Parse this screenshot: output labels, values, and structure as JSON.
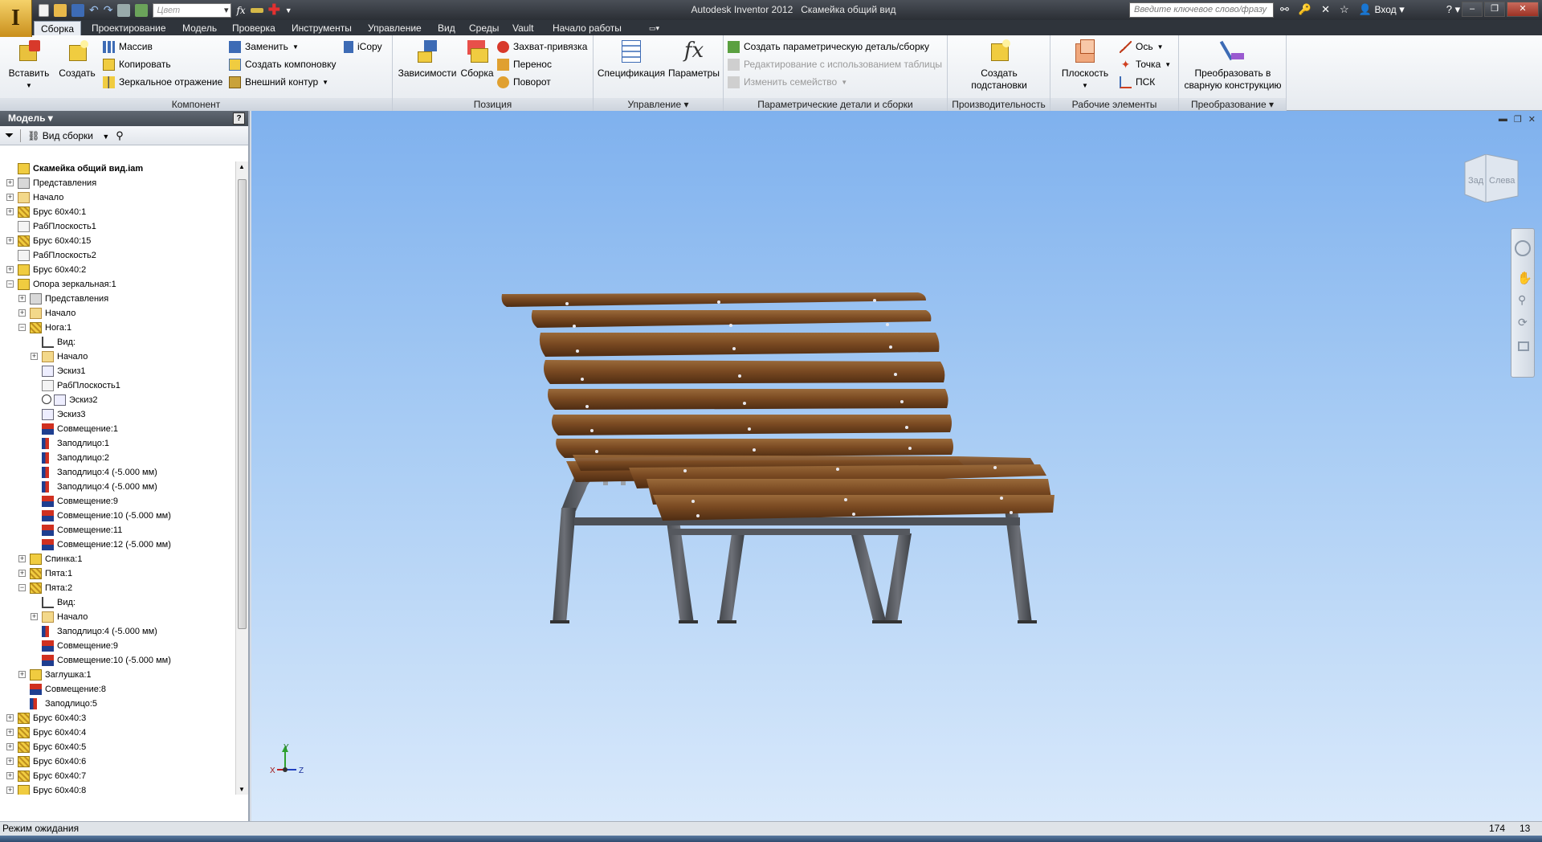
{
  "titlebar": {
    "app": "Autodesk Inventor 2012",
    "document": "Скамейка общий вид",
    "color_placeholder": "Цвет",
    "search_placeholder": "Введите ключевое слово/фразу",
    "login": "Вход"
  },
  "ribbon_tabs": [
    "Сборка",
    "Проектирование",
    "Модель",
    "Проверка",
    "Инструменты",
    "Управление",
    "Вид",
    "Среды",
    "Vault",
    "Начало работы"
  ],
  "ribbon": {
    "component": {
      "title": "Компонент",
      "insert": "Вставить",
      "create": "Создать",
      "pattern": "Массив",
      "copy": "Копировать",
      "mirror": "Зеркальное отражение",
      "replace": "Заменить",
      "create_layout": "Создать компоновку",
      "shrinkwrap": "Внешний контур",
      "icopy": "iCopy"
    },
    "position": {
      "title": "Позиция",
      "constraints": "Зависимости",
      "assembly": "Сборка",
      "grip_snap": "Захват-привязка",
      "move": "Перенос",
      "rotate": "Поворот"
    },
    "manage": {
      "title": "Управление",
      "bom": "Спецификация",
      "parameters": "Параметры"
    },
    "ipart": {
      "title": "Параметрические детали и сборки",
      "create_ipart": "Создать параметрическую деталь/сборку",
      "edit_table": "Редактирование с использованием таблицы",
      "change_family": "Изменить семейство"
    },
    "productivity": {
      "title": "Производительность",
      "create_substitutes_1": "Создать",
      "create_substitutes_2": "подстановки"
    },
    "work_features": {
      "title": "Рабочие элементы",
      "plane": "Плоскость",
      "axis": "Ось",
      "point": "Точка",
      "ucs": "ПСК"
    },
    "convert": {
      "title": "Преобразование",
      "convert_1": "Преобразовать в",
      "convert_2": "сварную конструкцию"
    }
  },
  "browser": {
    "title": "Модель",
    "view_label": "Вид сборки",
    "tree": [
      {
        "label": "Скамейка общий вид.iam",
        "level": 0,
        "toggle": "",
        "icon": "assembly-icon",
        "bold": true
      },
      {
        "label": "Представления",
        "level": 0,
        "toggle": "+",
        "icon": "representations-icon"
      },
      {
        "label": "Начало",
        "level": 0,
        "toggle": "+",
        "icon": "folder-icon"
      },
      {
        "label": "Брус 60x40:1",
        "level": 0,
        "toggle": "+",
        "icon": "part-adaptive-icon"
      },
      {
        "label": "РабПлоскость1",
        "level": 0,
        "toggle": "",
        "icon": "workplane-icon"
      },
      {
        "label": "Брус 60x40:15",
        "level": 0,
        "toggle": "+",
        "icon": "part-adaptive-icon"
      },
      {
        "label": "РабПлоскость2",
        "level": 0,
        "toggle": "",
        "icon": "workplane-icon"
      },
      {
        "label": "Брус 60x40:2",
        "level": 0,
        "toggle": "+",
        "icon": "part-icon"
      },
      {
        "label": "Опора зеркальная:1",
        "level": 0,
        "toggle": "−",
        "icon": "subassembly-icon"
      },
      {
        "label": "Представления",
        "level": 1,
        "toggle": "+",
        "icon": "representations-icon"
      },
      {
        "label": "Начало",
        "level": 1,
        "toggle": "+",
        "icon": "folder-icon"
      },
      {
        "label": "Нога:1",
        "level": 1,
        "toggle": "−",
        "icon": "part-adaptive-icon"
      },
      {
        "label": "Вид:",
        "level": 2,
        "toggle": "",
        "icon": "view-icon"
      },
      {
        "label": "Начало",
        "level": 2,
        "toggle": "+",
        "icon": "folder-icon"
      },
      {
        "label": "Эскиз1",
        "level": 2,
        "toggle": "",
        "icon": "sketch-icon"
      },
      {
        "label": "РабПлоскость1",
        "level": 2,
        "toggle": "",
        "icon": "workplane-icon"
      },
      {
        "label": "Эскиз2",
        "level": 2,
        "toggle": "",
        "icon": "sketch-info-icon"
      },
      {
        "label": "Эскиз3",
        "level": 2,
        "toggle": "",
        "icon": "sketch-icon"
      },
      {
        "label": "Совмещение:1",
        "level": 2,
        "toggle": "",
        "icon": "mate-constraint-icon"
      },
      {
        "label": "Заподлицо:1",
        "level": 2,
        "toggle": "",
        "icon": "flush-constraint-icon"
      },
      {
        "label": "Заподлицо:2",
        "level": 2,
        "toggle": "",
        "icon": "flush-constraint-icon"
      },
      {
        "label": "Заподлицо:4 (-5.000 мм)",
        "level": 2,
        "toggle": "",
        "icon": "flush-constraint-icon"
      },
      {
        "label": "Заподлицо:4 (-5.000 мм)",
        "level": 2,
        "toggle": "",
        "icon": "flush-constraint-icon"
      },
      {
        "label": "Совмещение:9",
        "level": 2,
        "toggle": "",
        "icon": "mate-constraint-icon"
      },
      {
        "label": "Совмещение:10 (-5.000 мм)",
        "level": 2,
        "toggle": "",
        "icon": "mate-constraint-icon"
      },
      {
        "label": "Совмещение:11",
        "level": 2,
        "toggle": "",
        "icon": "mate-constraint-icon"
      },
      {
        "label": "Совмещение:12 (-5.000 мм)",
        "level": 2,
        "toggle": "",
        "icon": "mate-constraint-icon"
      },
      {
        "label": "Спинка:1",
        "level": 1,
        "toggle": "+",
        "icon": "part-icon"
      },
      {
        "label": "Пята:1",
        "level": 1,
        "toggle": "+",
        "icon": "part-adaptive-icon"
      },
      {
        "label": "Пята:2",
        "level": 1,
        "toggle": "−",
        "icon": "part-adaptive-icon"
      },
      {
        "label": "Вид:",
        "level": 2,
        "toggle": "",
        "icon": "view-icon"
      },
      {
        "label": "Начало",
        "level": 2,
        "toggle": "+",
        "icon": "folder-icon"
      },
      {
        "label": "Заподлицо:4 (-5.000 мм)",
        "level": 2,
        "toggle": "",
        "icon": "flush-constraint-icon"
      },
      {
        "label": "Совмещение:9",
        "level": 2,
        "toggle": "",
        "icon": "mate-constraint-icon"
      },
      {
        "label": "Совмещение:10 (-5.000 мм)",
        "level": 2,
        "toggle": "",
        "icon": "mate-constraint-icon"
      },
      {
        "label": "Заглушка:1",
        "level": 1,
        "toggle": "+",
        "icon": "part-icon"
      },
      {
        "label": "Совмещение:8",
        "level": 1,
        "toggle": "",
        "icon": "mate-constraint-icon"
      },
      {
        "label": "Заподлицо:5",
        "level": 1,
        "toggle": "",
        "icon": "flush-constraint-icon"
      },
      {
        "label": "Брус 60x40:3",
        "level": 0,
        "toggle": "+",
        "icon": "part-adaptive-icon"
      },
      {
        "label": "Брус 60x40:4",
        "level": 0,
        "toggle": "+",
        "icon": "part-adaptive-icon"
      },
      {
        "label": "Брус 60x40:5",
        "level": 0,
        "toggle": "+",
        "icon": "part-adaptive-icon"
      },
      {
        "label": "Брус 60x40:6",
        "level": 0,
        "toggle": "+",
        "icon": "part-adaptive-icon"
      },
      {
        "label": "Брус 60x40:7",
        "level": 0,
        "toggle": "+",
        "icon": "part-adaptive-icon"
      },
      {
        "label": "Брус 60x40:8",
        "level": 0,
        "toggle": "+",
        "icon": "part-icon"
      }
    ]
  },
  "viewport": {
    "viewcube_left": "Зад",
    "viewcube_right": "Слева",
    "axis_x": "X",
    "axis_y": "Y",
    "axis_z": "Z"
  },
  "status": {
    "text": "Режим ожидания",
    "value1": "174",
    "value2": "13"
  },
  "colors": {
    "wood": "#7a4a22",
    "steel": "#5d6066",
    "sky_top": "#7fb1ee",
    "sky_bottom": "#d9e9fb"
  }
}
